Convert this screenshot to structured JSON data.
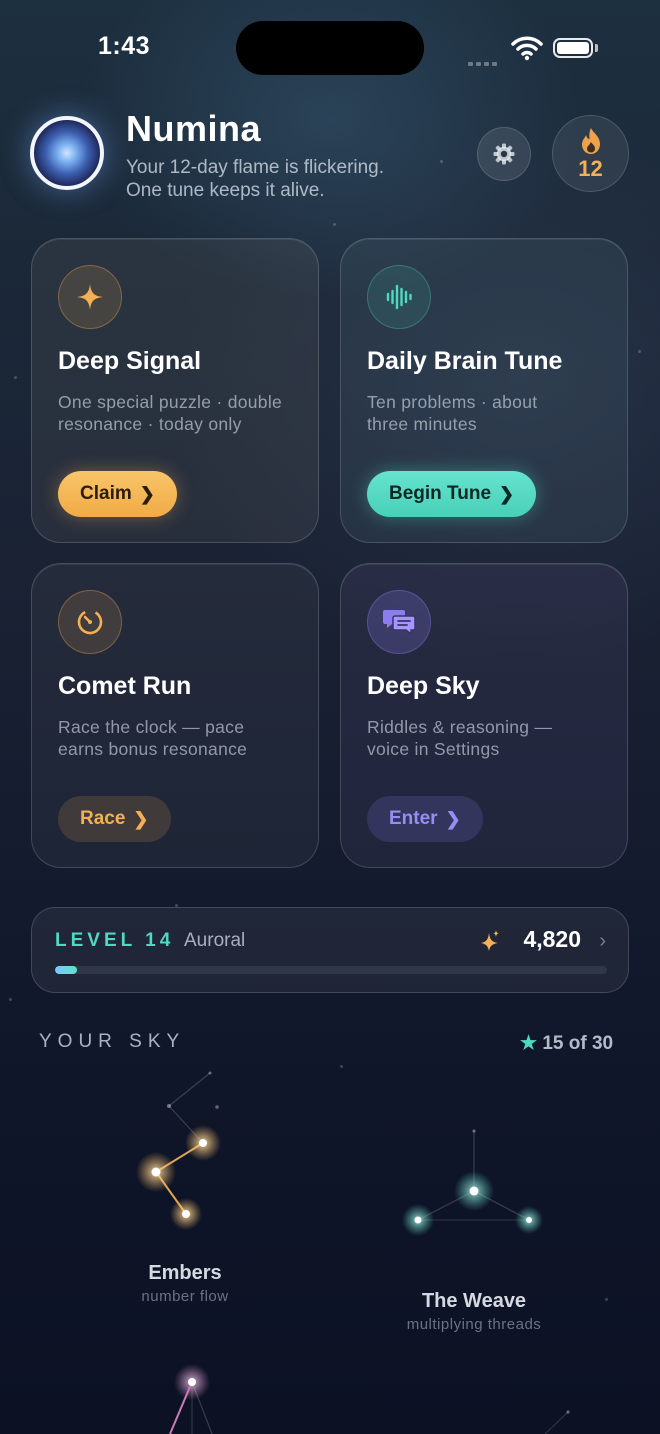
{
  "status_bar": {
    "time": "1:43"
  },
  "header": {
    "title": "Numina",
    "subtitle_line1": "Your 12-day flame is flickering.",
    "subtitle_line2": "One tune keeps it alive.",
    "streak_count": "12"
  },
  "cards": [
    {
      "title": "Deep Signal",
      "desc_line1": "One special puzzle · double",
      "desc_line2": "resonance · today only",
      "button": "Claim",
      "icon": "sparkle-icon"
    },
    {
      "title": "Daily Brain Tune",
      "desc_line1": "Ten problems · about",
      "desc_line2": "three minutes",
      "button": "Begin Tune",
      "icon": "waveform-icon"
    },
    {
      "title": "Comet Run",
      "desc_line1": "Race the clock — pace",
      "desc_line2": "earns bonus resonance",
      "button": "Race",
      "icon": "timer-icon"
    },
    {
      "title": "Deep Sky",
      "desc_line1": "Riddles & reasoning —",
      "desc_line2": "voice in Settings",
      "button": "Enter",
      "icon": "chat-bubbles-icon"
    }
  ],
  "level": {
    "label": "LEVEL 14",
    "rank": "Auroral",
    "xp": "4,820",
    "progress": 0.04
  },
  "sky": {
    "title": "YOUR SKY",
    "count": "15 of 30",
    "constellations": [
      {
        "name": "Embers",
        "subtitle": "number flow"
      },
      {
        "name": "The Weave",
        "subtitle": "multiplying threads"
      }
    ]
  },
  "colors": {
    "accent_teal": "#4fd8c2",
    "accent_gold": "#f5b055",
    "accent_purple": "#8b7cf0"
  }
}
